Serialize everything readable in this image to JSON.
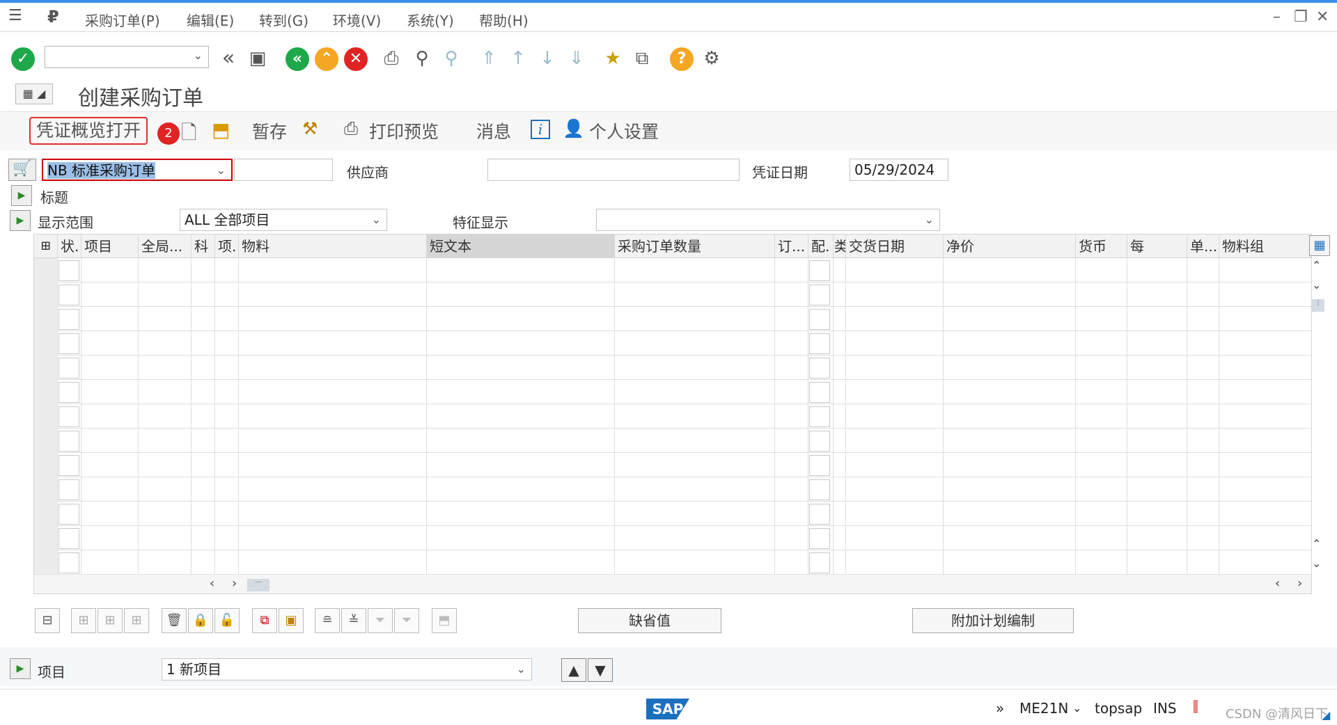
{
  "menu": {
    "items": [
      "采购订单(P)",
      "编辑(E)",
      "转到(G)",
      "环境(V)",
      "系统(Y)",
      "帮助(H)"
    ]
  },
  "toolbar": {
    "command_value": ""
  },
  "page": {
    "title": "创建采购订单"
  },
  "app_toolbar": {
    "overview": "凭证概览打开",
    "badge": "2",
    "hold": "暂存",
    "print_preview": "打印预览",
    "messages": "消息",
    "personal": "个人设置"
  },
  "header": {
    "order_type": "NB 标准采购订单",
    "vendor_label": "供应商",
    "vendor_value": "",
    "doc_date_label": "凭证日期",
    "doc_date": "05/29/2024",
    "header_label": "标题"
  },
  "display": {
    "range_label": "显示范围",
    "range_value": "ALL 全部项目",
    "feature_label": "特征显示",
    "feature_value": ""
  },
  "grid": {
    "columns": [
      "状.",
      "项目",
      "全局...",
      "科",
      "项.",
      "物料",
      "短文本",
      "采购订单数量",
      "订...",
      "配.",
      "类",
      "交货日期",
      "净价",
      "货币",
      "每",
      "单...",
      "物料组"
    ],
    "rows": 13
  },
  "bottom": {
    "defaults_btn": "缺省值",
    "addl_planning_btn": "附加计划编制"
  },
  "item_selector": {
    "label": "项目",
    "value": "1 新项目"
  },
  "status": {
    "arrow": "»",
    "tcode": "ME21N",
    "system": "topsap",
    "mode": "INS",
    "watermark": "CSDN @清风日下"
  },
  "colors": {
    "accent": "#3a8ee6",
    "green": "#1ea84a",
    "orange": "#f5a623",
    "red": "#e02424"
  }
}
